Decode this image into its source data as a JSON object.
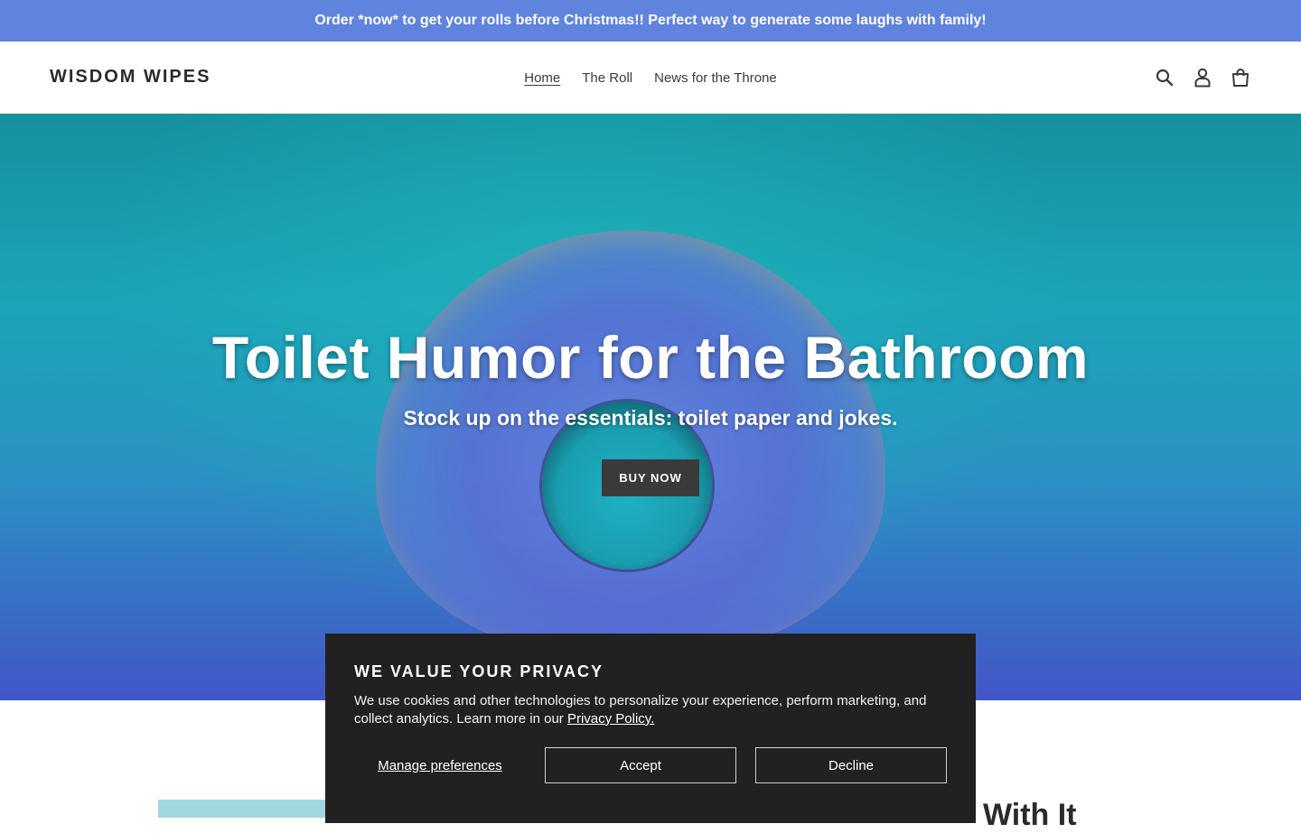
{
  "announcement": {
    "text": "Order *now* to get your rolls before Christmas!! Perfect way to generate some laughs with family!"
  },
  "header": {
    "logo": "WISDOM WIPES",
    "nav": [
      "Home",
      "The Roll",
      "News for the Throne"
    ],
    "active_nav": "Home",
    "icons": [
      "search-icon",
      "account-icon",
      "cart-icon"
    ]
  },
  "hero": {
    "title": "Toilet Humor for the Bathroom",
    "subtitle": "Stock up on the essentials: toilet paper and jokes.",
    "button": "BUY NOW"
  },
  "below": {
    "heading_fragment": "With It"
  },
  "cookie": {
    "title": "WE VALUE YOUR PRIVACY",
    "text": "We use cookies and other technologies to personalize your experience, perform marketing, and collect analytics. Learn more in our",
    "link": "Privacy Policy.",
    "manage": "Manage preferences",
    "accept": "Accept",
    "decline": "Decline"
  },
  "colors": {
    "announcement_bg": "#6083dd",
    "cookie_bg": "#212121",
    "button_bg": "#3a3a3a"
  }
}
